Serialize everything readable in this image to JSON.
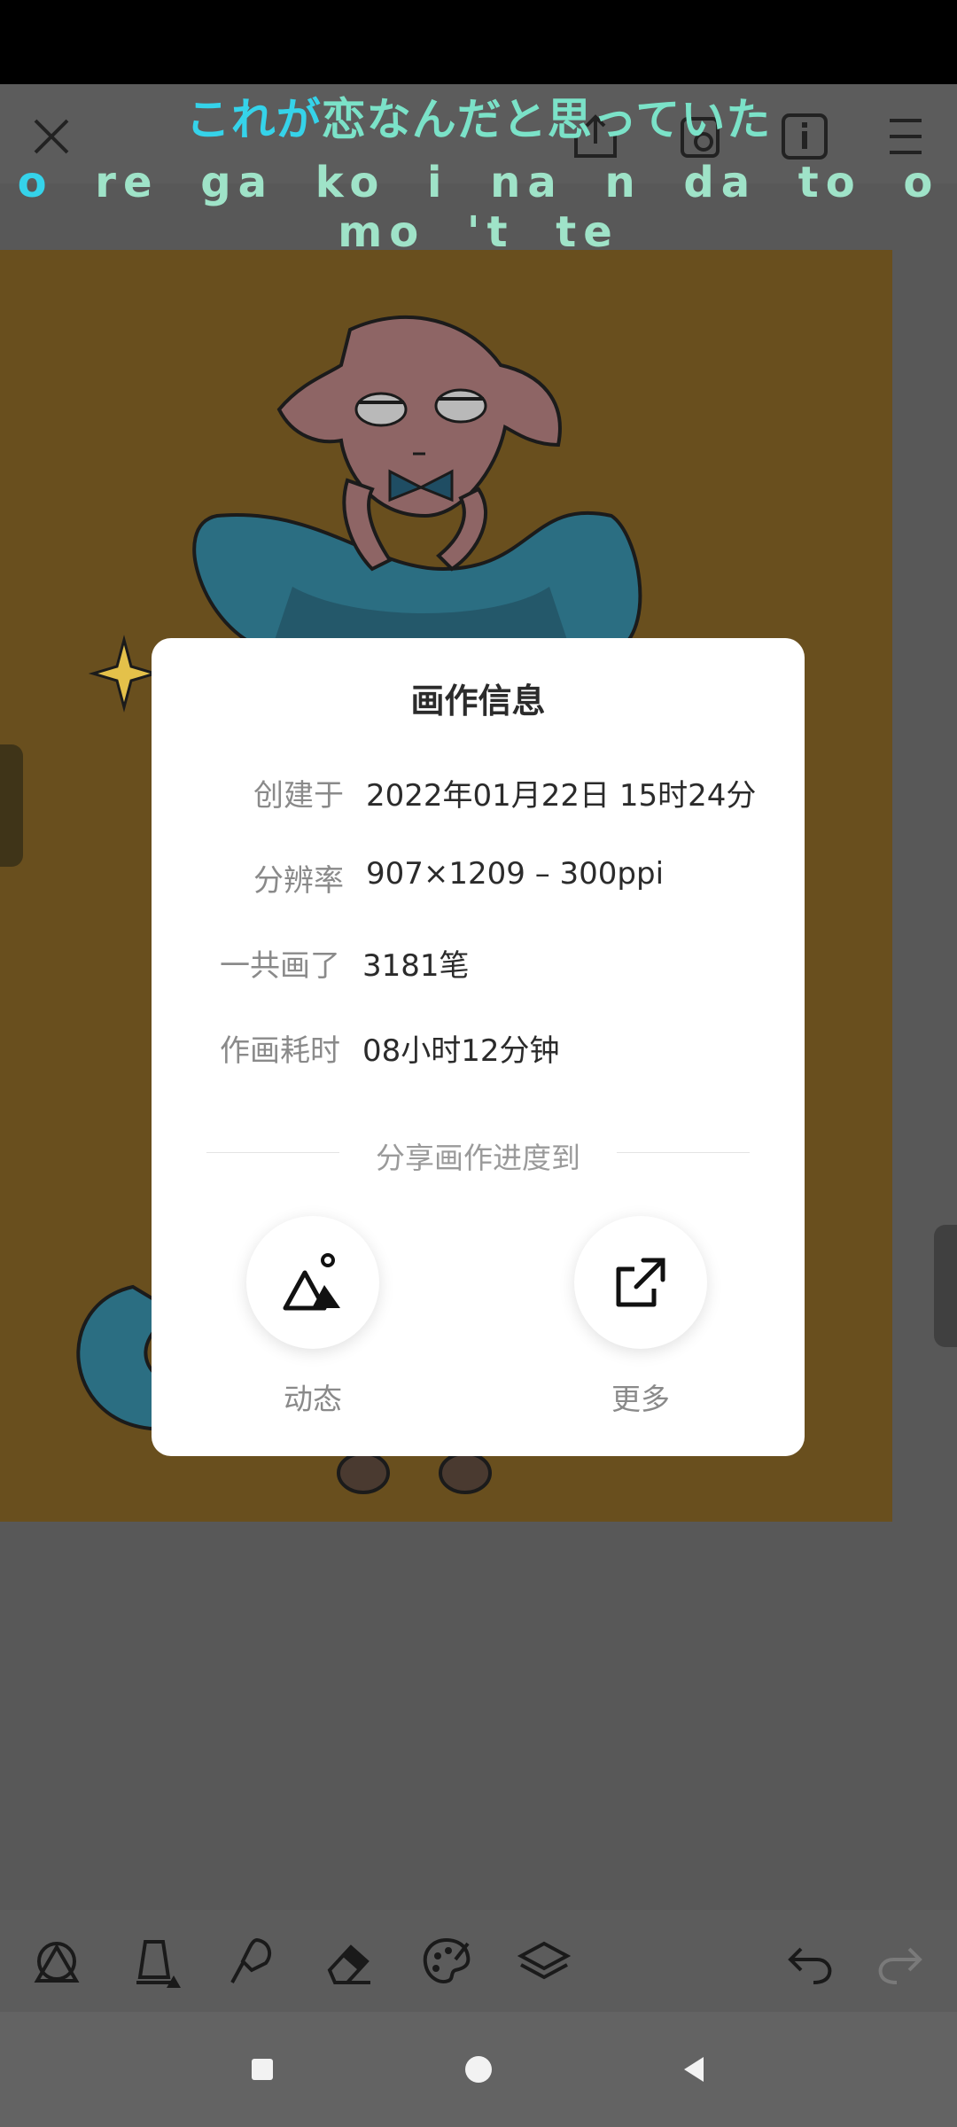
{
  "lyrics": {
    "line1_highlight": "これが",
    "line1_rest": "恋なんだと思っていた",
    "line2_first": "o",
    "line2_rest": "re ga ko i na n da to o mo 't te"
  },
  "toolbar": {
    "close_icon": "close-icon",
    "export_icon": "export-icon",
    "share_icon": "share-icon",
    "info_icon": "info-icon",
    "menu_icon": "menu-icon"
  },
  "dialog": {
    "title": "画作信息",
    "rows": [
      {
        "label": "创建于",
        "value": "2022年01月22日 15时24分"
      },
      {
        "label": "分辨率",
        "value": "907×1209 – 300ppi"
      },
      {
        "label": "一共画了",
        "value": "3181笔"
      },
      {
        "label": "作画耗时",
        "value": "08小时12分钟"
      }
    ],
    "share_heading": "分享画作进度到",
    "share_moments": "动态",
    "share_more": "更多"
  },
  "bottom_tools": [
    "shape-tool-icon",
    "fill-tool-icon",
    "brush-tool-icon",
    "eraser-tool-icon",
    "palette-icon",
    "layers-icon",
    "undo-icon",
    "redo-icon"
  ],
  "colors": {
    "artwork_bg": "#694f1e",
    "lyric_cyan": "#35d3ea",
    "lyric_mint": "#7be2c8"
  }
}
